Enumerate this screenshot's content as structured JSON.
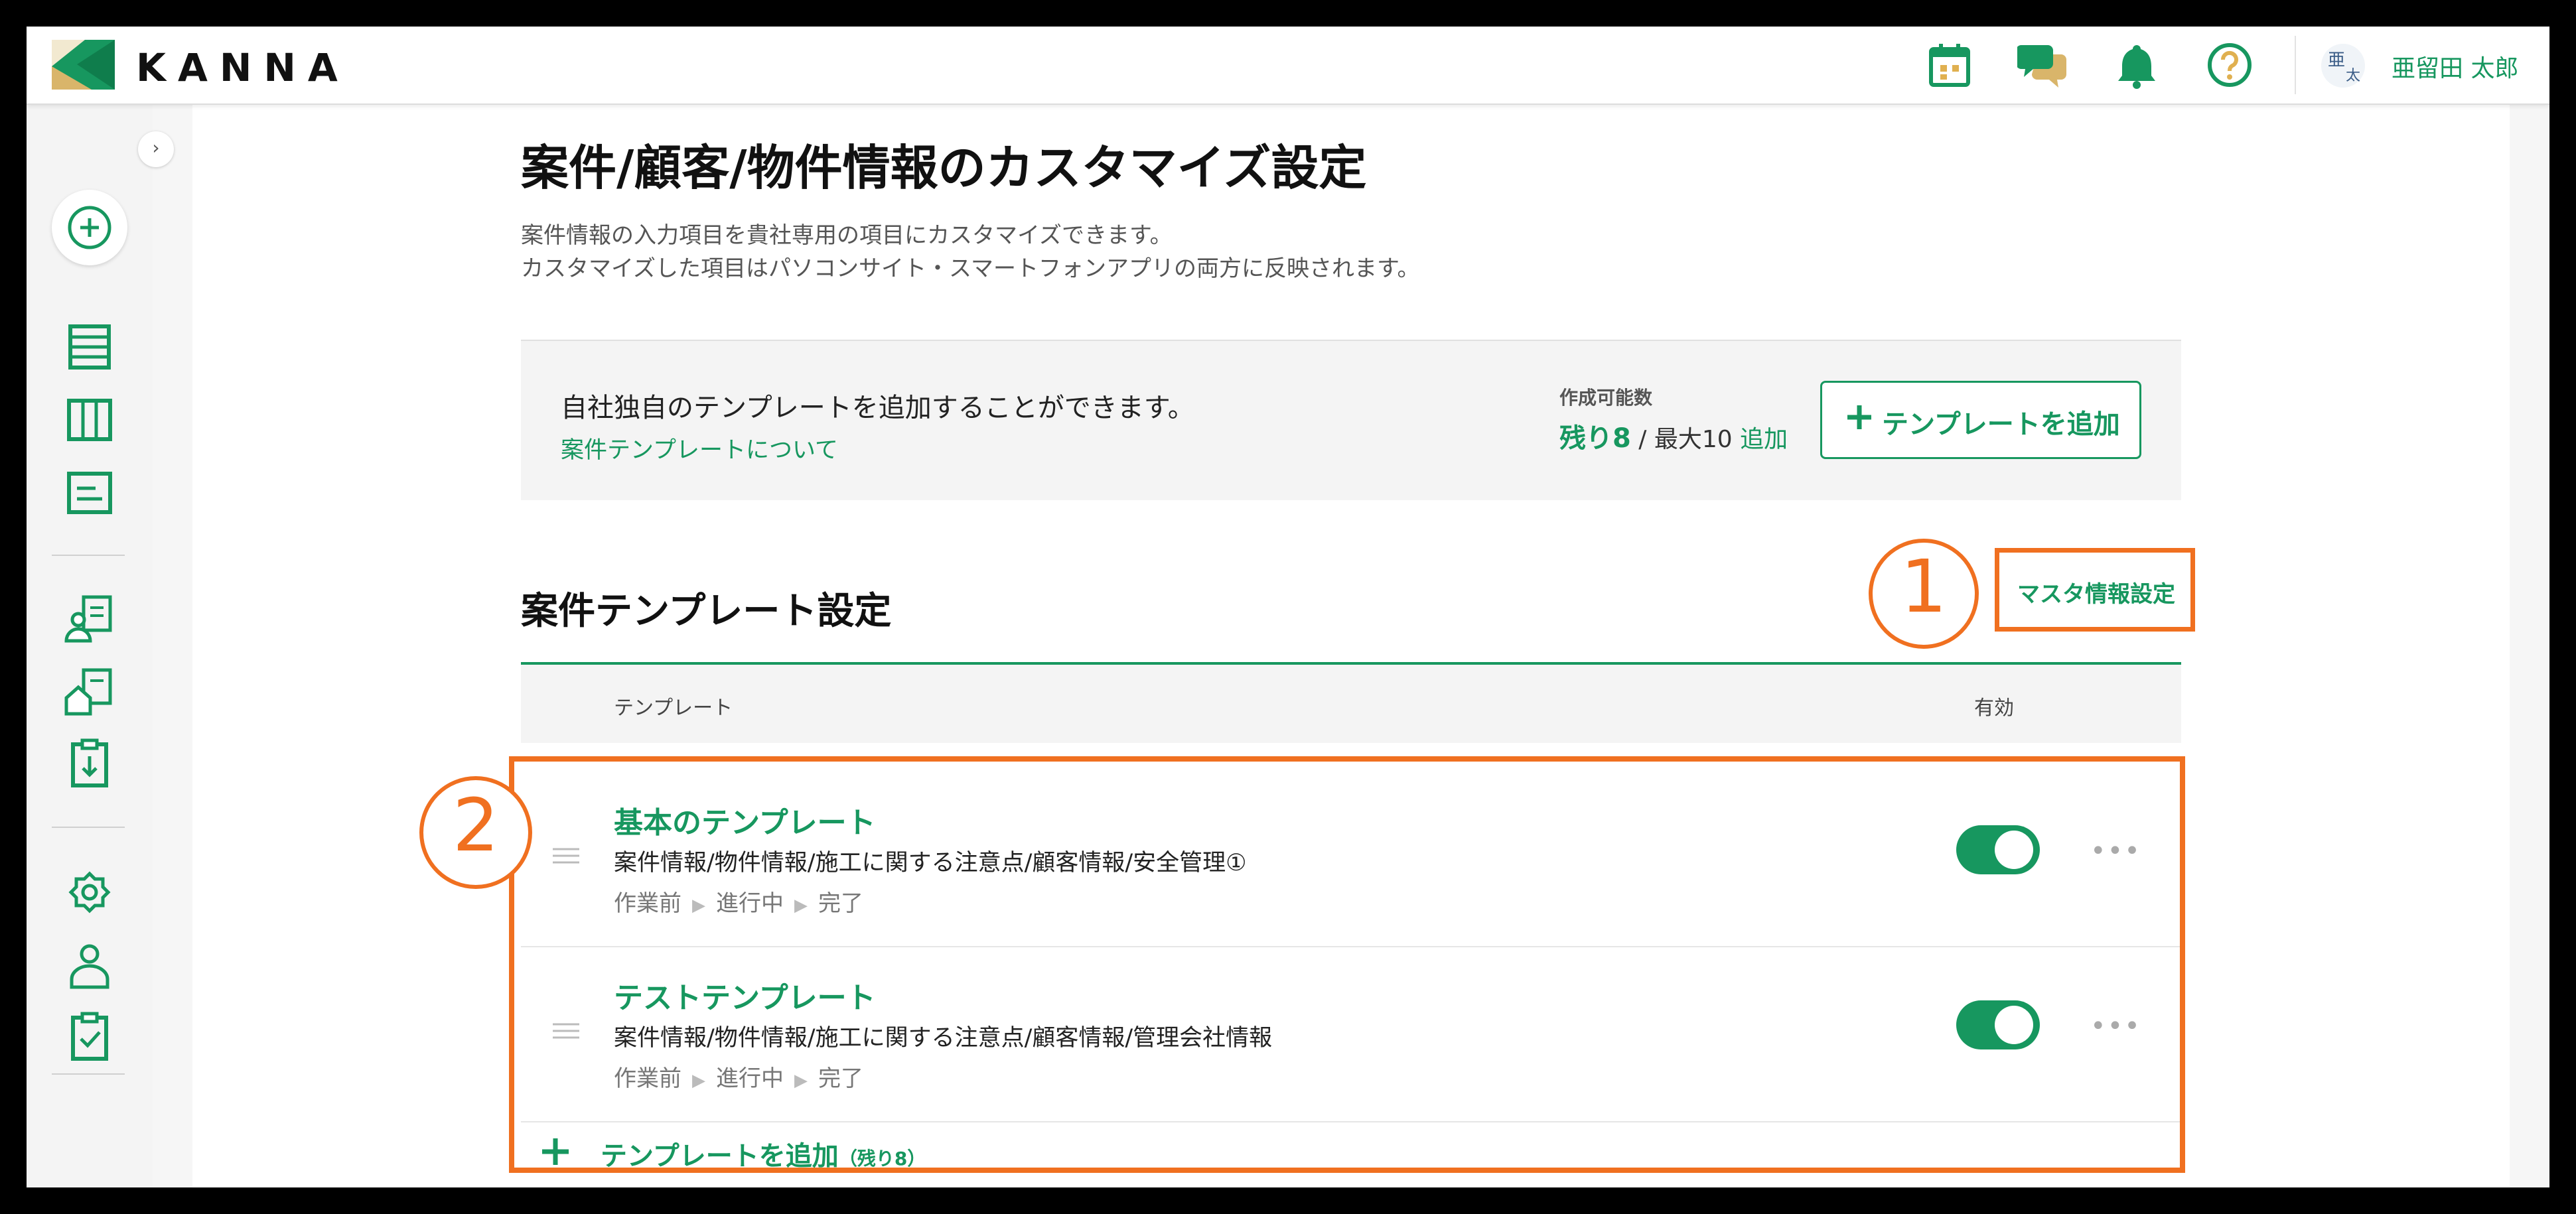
{
  "app": {
    "logo_text": "KANNA"
  },
  "header": {
    "user": {
      "avatar_line1": "亜",
      "avatar_line2": "太",
      "name": "亜留田 太郎"
    }
  },
  "page": {
    "title": "案件/顧客/物件情報のカスタマイズ設定",
    "description_line1": "案件情報の入力項目を貴社専用の項目にカスタマイズできます。",
    "description_line2": "カスタマイズした項目はパソコンサイト・スマートフォンアプリの両方に反映されます。"
  },
  "info_box": {
    "message": "自社独自のテンプレートを追加することができます。",
    "link": "案件テンプレートについて",
    "capacity_label": "作成可能数",
    "remaining": "残り8",
    "max_text": "/ 最大10",
    "add_link": "追加",
    "add_button": "テンプレートを追加"
  },
  "section": {
    "title": "案件テンプレート設定",
    "master_button": "マスタ情報設定",
    "column_template": "テンプレート",
    "column_valid": "有効"
  },
  "annotations": {
    "marker1": "1",
    "marker2": "2"
  },
  "templates": [
    {
      "name": "基本のテンプレート",
      "items": "案件情報/物件情報/施工に関する注意点/顧客情報/安全管理①",
      "status": [
        "作業前",
        "進行中",
        "完了"
      ],
      "enabled": true
    },
    {
      "name": "テストテンプレート",
      "items": "案件情報/物件情報/施工に関する注意点/顧客情報/管理会社情報",
      "status": [
        "作業前",
        "進行中",
        "完了"
      ],
      "enabled": true
    }
  ],
  "add_template": {
    "label": "テンプレートを追加",
    "remaining": "（残り8）"
  },
  "colors": {
    "brand_green": "#17975f",
    "annotation_orange": "#f07020"
  },
  "icons": {
    "header": [
      "calendar-icon",
      "chat-icon",
      "bell-icon",
      "help-icon"
    ],
    "sidebar": [
      "add-icon",
      "list-icon",
      "board-icon",
      "document-icon",
      "customer-icon",
      "property-icon",
      "download-report-icon",
      "settings-icon",
      "user-icon",
      "checklist-icon"
    ]
  }
}
